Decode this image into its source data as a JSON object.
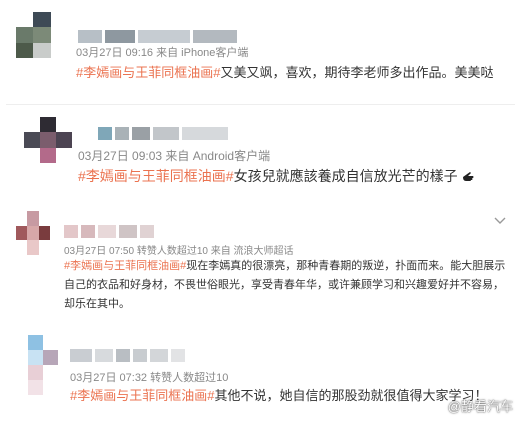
{
  "comments": [
    {
      "meta": "03月27日 09:16  来自 iPhone客户端",
      "topic": "#李嫣画与王菲同框油画#",
      "body": "又美又飒，喜欢，期待李老师多出作品。美美哒"
    },
    {
      "meta": "03月27日 09:03  来自 Android客户端",
      "topic": "#李嫣画与王菲同框油画#",
      "body": "女孩兒就應該養成自信放光芒的樣子"
    },
    {
      "meta": "03月27日 07:50  转赞人数超过10  来自 流浪大师超话",
      "topic": "#李嫣画与王菲同框油画#",
      "body": "现在李嫣真的很漂亮，那种青春期的叛逆，扑面而来。能大胆展示自己的衣品和好身材，不畏世俗眼光，享受青春年华，或许兼顾学习和兴趣爱好并不容易，却乐在其中。"
    },
    {
      "meta": "03月27日 07:32  转赞人数超过10",
      "topic": "#李嫣画与王菲同框油画#",
      "body": "其他不说，她自信的那股劲就很值得大家学习！"
    }
  ],
  "watermark": "@静看汽车",
  "icons": {
    "menu": "chevron-down-icon",
    "hand": "pointing-hand-icon"
  }
}
